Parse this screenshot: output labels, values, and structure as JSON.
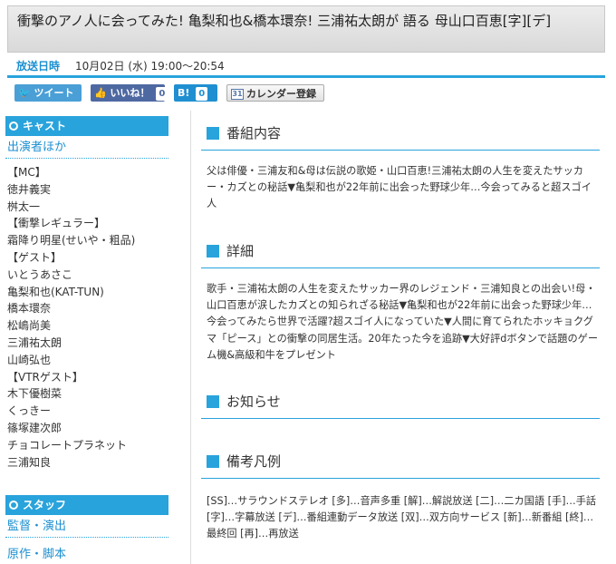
{
  "title": "衝撃のアノ人に会ってみた! 亀梨和也&橋本環奈! 三浦祐太朗が 語る 母山口百恵[字][デ]",
  "airtime": {
    "label": "放送日時",
    "value": "10月02日 (水) 19:00～20:54"
  },
  "social": {
    "tweet": "ツイート",
    "like": "いいね！",
    "like_count": "0",
    "hatena": "B!",
    "hatena_count": "0",
    "calendar": "カレンダー登録",
    "calendar_icon": "31"
  },
  "sidebar": {
    "cast_heading": "キャスト",
    "cast_sub": "出演者ほか",
    "cast": [
      "【MC】",
      "徳井義実",
      "桝太一",
      "【衝撃レギュラー】",
      "霜降り明星(せいや・粗品)",
      "【ゲスト】",
      "いとうあさこ",
      "亀梨和也(KAT-TUN)",
      "橋本環奈",
      "松嶋尚美",
      "三浦祐太朗",
      "山崎弘也",
      "【VTRゲスト】",
      "木下優樹菜",
      "くっきー",
      "篠塚建次郎",
      "チョコレートプラネット",
      "三浦知良"
    ],
    "staff_heading": "スタッフ",
    "staff_sub1": "監督・演出",
    "staff_sub2": "原作・脚本"
  },
  "main": {
    "sections": [
      {
        "heading": "番組内容",
        "body": "父は俳優・三浦友和&母は伝説の歌姫・山口百恵!三浦祐太朗の人生を変えたサッカー・カズとの秘話▼亀梨和也が22年前に出会った野球少年…今会ってみると超スゴイ人"
      },
      {
        "heading": "詳細",
        "body": "歌手・三浦祐太朗の人生を変えたサッカー界のレジェンド・三浦知良との出会い!母・山口百恵が涙したカズとの知られざる秘話▼亀梨和也が22年前に出会った野球少年…今会ってみたら世界で活躍?超スゴイ人になっていた▼人間に育てられたホッキョクグマ「ピース」との衝撃の同居生活。20年たった今を追跡▼大好評dボタンで話題のゲーム機&高級和牛をプレゼント"
      },
      {
        "heading": "お知らせ",
        "body": ""
      },
      {
        "heading": "備考凡例",
        "body": "[SS]…サラウンドステレオ [多]…音声多重 [解]…解説放送 [二]…二カ国語 [手]…手話 [字]…字幕放送 [デ]…番組連動データ放送 [双]…双方向サービス [新]…新番組 [終]…最終回 [再]…再放送"
      }
    ]
  },
  "colors": {
    "accent": "#29a3dc",
    "like": "#4e69a2",
    "tweet": "#4a9fd6"
  }
}
